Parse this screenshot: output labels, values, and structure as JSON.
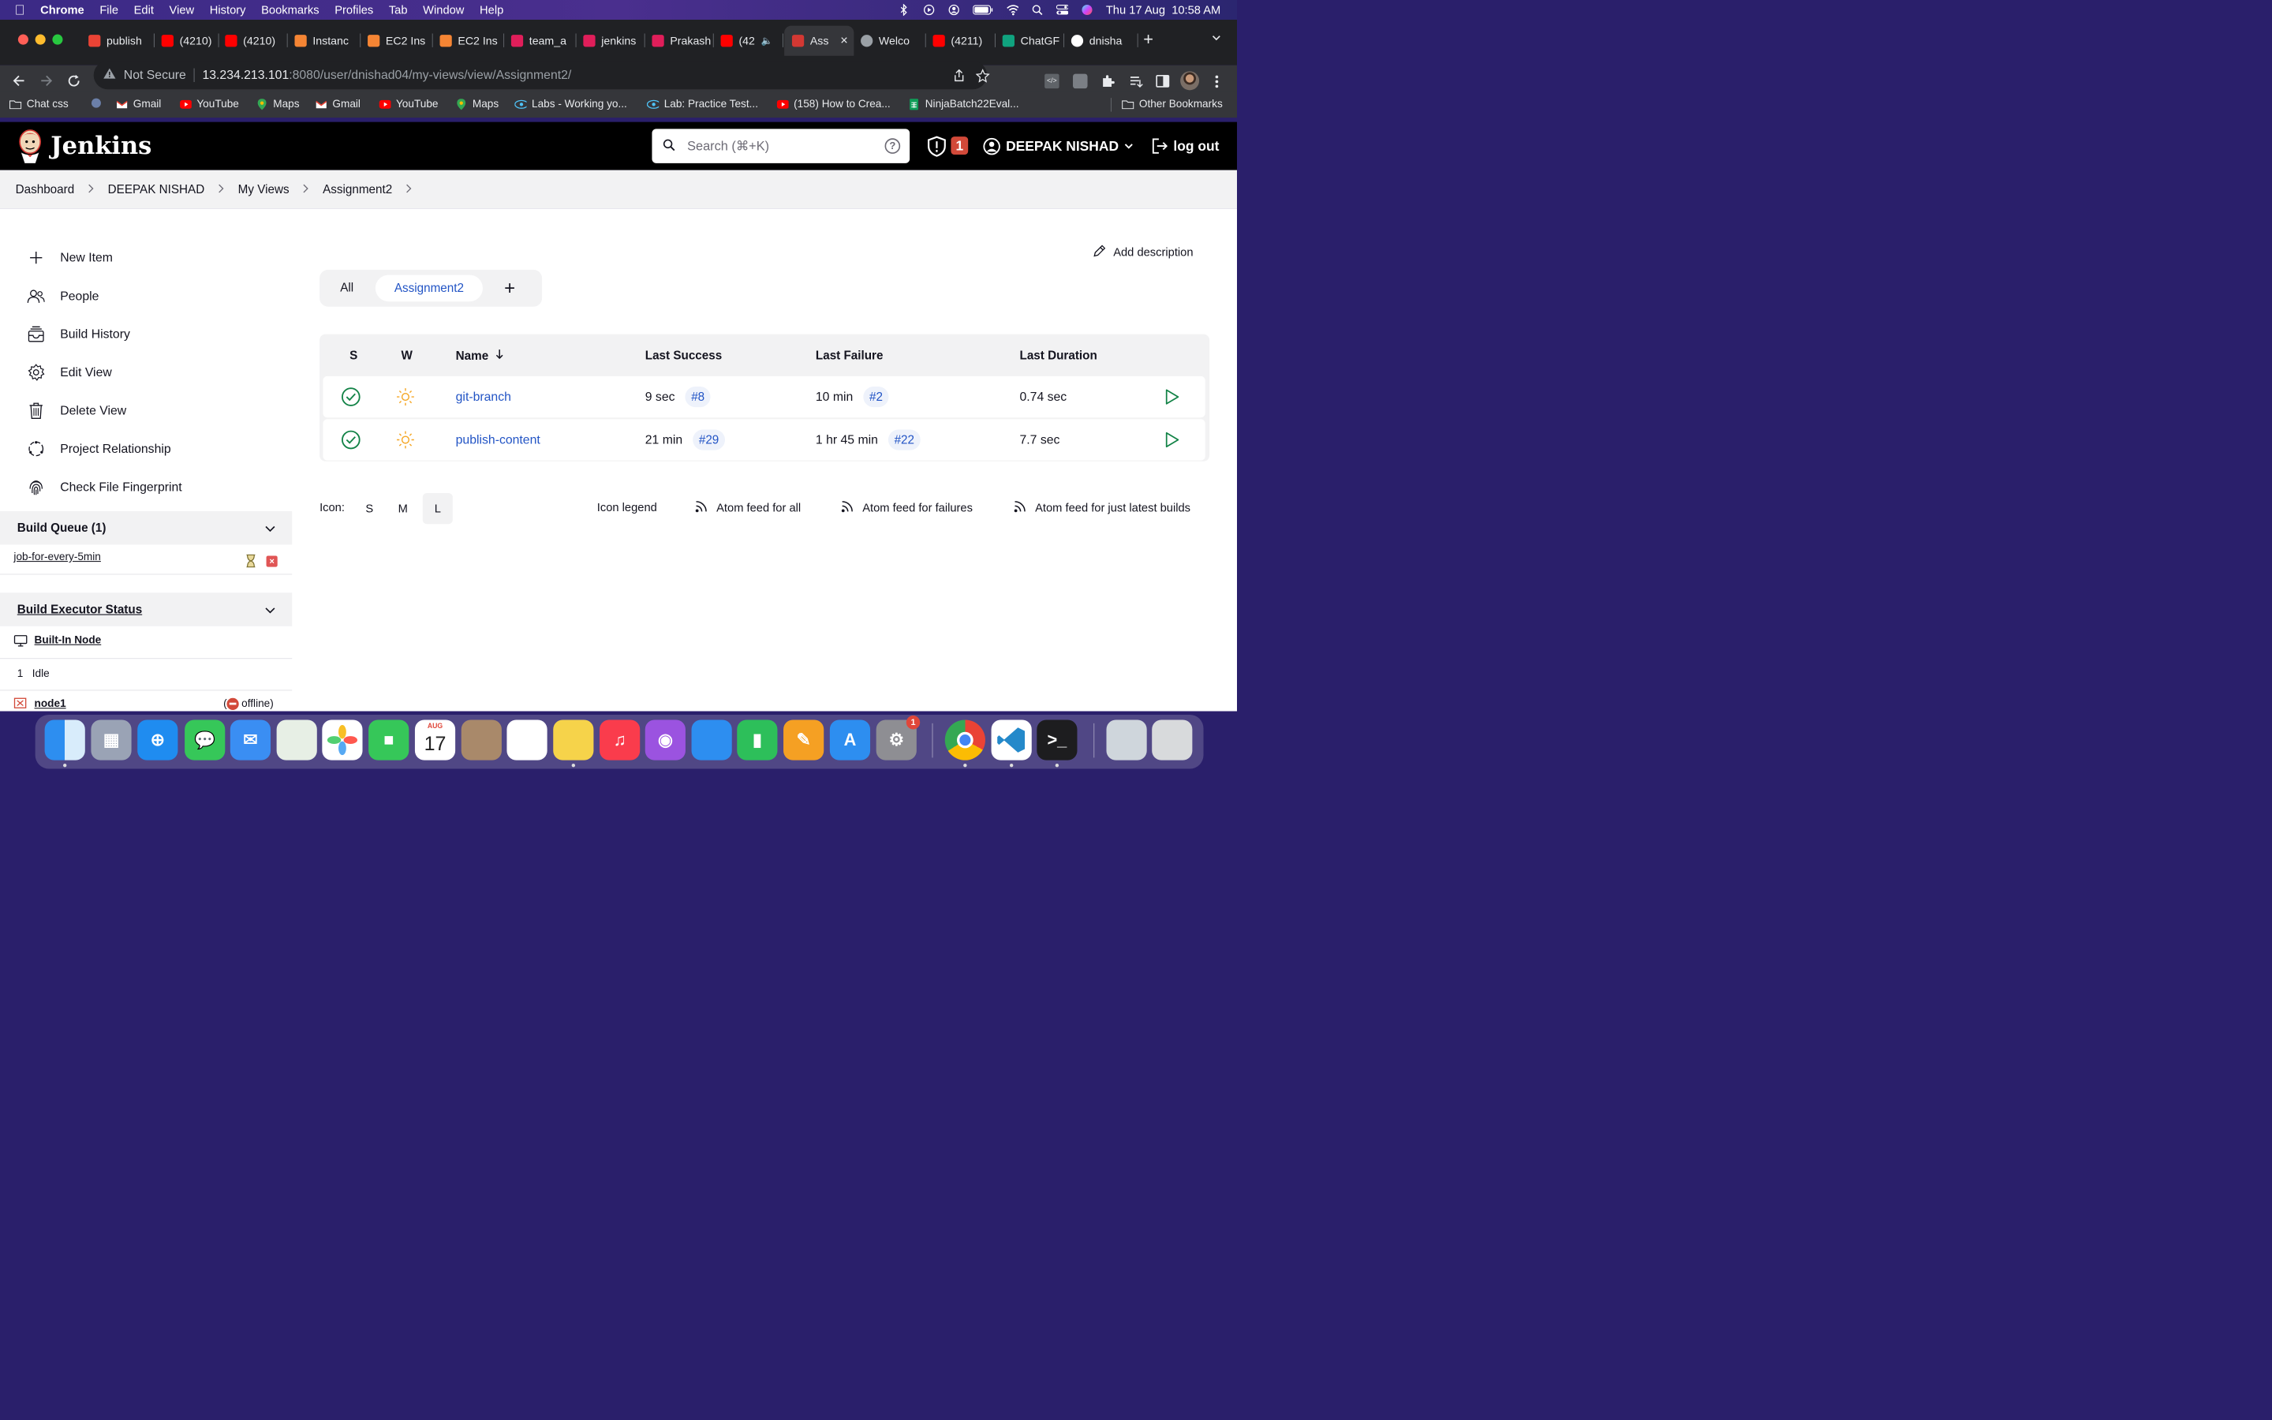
{
  "menubar": {
    "app": "Chrome",
    "items": [
      "File",
      "Edit",
      "View",
      "History",
      "Bookmarks",
      "Profiles",
      "Tab",
      "Window",
      "Help"
    ],
    "clock": "Thu 17 Aug  10:58 AM"
  },
  "tabs": [
    {
      "label": "publish",
      "icon": "gmail-icon",
      "color": "#ea4335"
    },
    {
      "label": "(4210)",
      "icon": "youtube-icon",
      "color": "#ff0000"
    },
    {
      "label": "(4210)",
      "icon": "youtube-icon",
      "color": "#ff0000"
    },
    {
      "label": "Instanc",
      "icon": "aws-icon",
      "color": "#f58534"
    },
    {
      "label": "EC2 Ins",
      "icon": "ec2-icon",
      "color": "#f58534"
    },
    {
      "label": "EC2 Ins",
      "icon": "ec2-icon",
      "color": "#f58534"
    },
    {
      "label": "team_a",
      "icon": "slack-icon",
      "color": "#e01e5a"
    },
    {
      "label": "jenkins",
      "icon": "slack-icon",
      "color": "#e01e5a"
    },
    {
      "label": "Prakash",
      "icon": "slack-icon",
      "color": "#e01e5a"
    },
    {
      "label": "(42",
      "icon": "youtube-icon",
      "color": "#ff0000"
    },
    {
      "label": "Ass",
      "icon": "jenkins-icon",
      "color": "#d33833"
    },
    {
      "label": "Welco",
      "icon": "globe-icon",
      "color": "#9aa0a6"
    },
    {
      "label": "(4211)",
      "icon": "youtube-icon",
      "color": "#ff0000"
    },
    {
      "label": "ChatGF",
      "icon": "chatgpt-icon",
      "color": "#10a37f"
    },
    {
      "label": "dnisha",
      "icon": "github-icon",
      "color": "#ffffff"
    }
  ],
  "address": {
    "security": "Not Secure",
    "host": "13.234.213.101",
    "rest": ":8080/user/dnishad04/my-views/view/Assignment2/"
  },
  "bookmarks": [
    {
      "label": "Chat css",
      "icon": "folder-icon"
    },
    {
      "label": "",
      "icon": "extension-icon"
    },
    {
      "label": "Gmail",
      "icon": "gmail-icon"
    },
    {
      "label": "YouTube",
      "icon": "youtube-icon"
    },
    {
      "label": "Maps",
      "icon": "maps-icon"
    },
    {
      "label": "Gmail",
      "icon": "gmail-icon"
    },
    {
      "label": "YouTube",
      "icon": "youtube-icon"
    },
    {
      "label": "Maps",
      "icon": "maps-icon"
    },
    {
      "label": "Labs - Working yo...",
      "icon": "labs-icon"
    },
    {
      "label": "Lab: Practice Test...",
      "icon": "labs-icon"
    },
    {
      "label": "(158) How to Crea...",
      "icon": "youtube-icon"
    },
    {
      "label": "NinjaBatch22Eval...",
      "icon": "sheets-icon"
    }
  ],
  "other_bookmarks": "Other Bookmarks",
  "jenkins": {
    "brand": "Jenkins",
    "search_placeholder": "Search (⌘+K)",
    "alerts": "1",
    "user": "DEEPAK NISHAD",
    "logout": "log out"
  },
  "breadcrumbs": [
    "Dashboard",
    "DEEPAK NISHAD",
    "My Views",
    "Assignment2"
  ],
  "sidebar": {
    "items": [
      {
        "label": "New Item",
        "icon": "plus-icon"
      },
      {
        "label": "People",
        "icon": "people-icon"
      },
      {
        "label": "Build History",
        "icon": "build-history-icon"
      },
      {
        "label": "Edit View",
        "icon": "gear-icon"
      },
      {
        "label": "Delete View",
        "icon": "trash-icon"
      },
      {
        "label": "Project Relationship",
        "icon": "relationship-icon"
      },
      {
        "label": "Check File Fingerprint",
        "icon": "fingerprint-icon"
      }
    ],
    "build_queue": {
      "title": "Build Queue (1)",
      "jobs": [
        "job-for-every-5min"
      ]
    },
    "executor": {
      "title": "Build Executor Status",
      "node": "Built-In Node",
      "slot_num": "1",
      "slot_state": "Idle",
      "node2": "node1",
      "node2_status": "offline)",
      "node2_paren": "("
    }
  },
  "main": {
    "add_description": "Add description",
    "view_tabs": [
      "All",
      "Assignment2"
    ],
    "columns": {
      "s": "S",
      "w": "W",
      "name": "Name",
      "last_success": "Last Success",
      "last_failure": "Last Failure",
      "last_duration": "Last Duration"
    },
    "jobs": [
      {
        "name": "git-branch",
        "last_success": "9 sec",
        "success_build": "#8",
        "last_failure": "10 min",
        "failure_build": "#2",
        "duration": "0.74 sec"
      },
      {
        "name": "publish-content",
        "last_success": "21 min",
        "success_build": "#29",
        "last_failure": "1 hr 45 min",
        "failure_build": "#22",
        "duration": "7.7 sec"
      }
    ],
    "footer": {
      "icon_label": "Icon:",
      "sizes": [
        "S",
        "M",
        "L"
      ],
      "selected_size": "L",
      "legend": "Icon legend",
      "feed_all": "Atom feed for all",
      "feed_failures": "Atom feed for failures",
      "feed_latest": "Atom feed for just latest builds"
    }
  },
  "dock": {
    "apps": [
      "Finder",
      "Launchpad",
      "Safari",
      "Messages",
      "Mail",
      "Maps",
      "Photos",
      "FaceTime",
      "Calendar",
      "Contacts",
      "Reminders",
      "Notes",
      "Music",
      "Podcasts",
      "Keynote",
      "Numbers",
      "Pages",
      "App Store",
      "System Settings",
      "Chrome",
      "VS Code",
      "Terminal",
      "Preview",
      "Trash"
    ],
    "calendar_month": "AUG",
    "calendar_day": "17",
    "settings_badge": "1"
  },
  "colors": {
    "jenkins_header": "#000000",
    "link": "#2254c5",
    "success": "#138347",
    "sunny": "#f5a623",
    "alert": "#d24939"
  }
}
